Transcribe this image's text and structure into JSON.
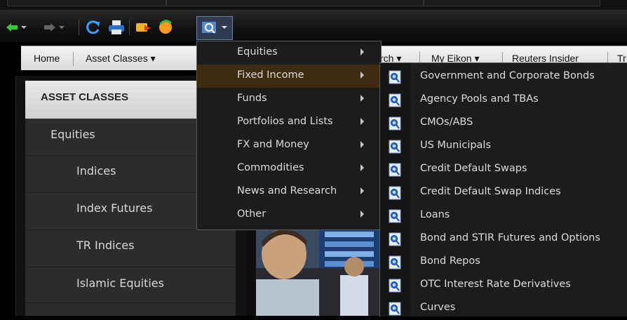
{
  "nav": {
    "home": "Home",
    "asset_classes": "Asset Classes ▾",
    "search": "rch ▾",
    "my_eikon": "My Eikon ▾",
    "reuters_insider": "Reuters Insider",
    "more": "Tr"
  },
  "left_panel": {
    "title": "ASSET CLASSES",
    "items": [
      {
        "label": "Equities"
      },
      {
        "label": "Indices"
      },
      {
        "label": "Index Futures"
      },
      {
        "label": "TR Indices"
      },
      {
        "label": "Islamic Equities"
      }
    ]
  },
  "menu_main": {
    "items": [
      {
        "label": "Equities"
      },
      {
        "label": "Fixed Income",
        "highlighted": true
      },
      {
        "label": "Funds"
      },
      {
        "label": "Portfolios and Lists"
      },
      {
        "label": "FX and Money"
      },
      {
        "label": "Commodities"
      },
      {
        "label": "News and Research"
      },
      {
        "label": "Other"
      }
    ]
  },
  "menu_fixed_income": {
    "items": [
      {
        "label": "Government and Corporate Bonds"
      },
      {
        "label": "Agency Pools and TBAs"
      },
      {
        "label": "CMOs/ABS"
      },
      {
        "label": "US Municipals"
      },
      {
        "label": "Credit Default Swaps"
      },
      {
        "label": "Credit Default Swap Indices"
      },
      {
        "label": "Loans"
      },
      {
        "label": "Bond and STIR Futures and Options"
      },
      {
        "label": "Bond Repos"
      },
      {
        "label": "OTC Interest Rate Derivatives"
      },
      {
        "label": "Curves"
      }
    ]
  },
  "colors": {
    "highlight": "#3e2c10",
    "menu_bg": "#1c1c1c",
    "nav_bg": "#e4e4e4",
    "panel_bg": "#2c2c2c"
  },
  "icons": {
    "back": "arrow-left-icon",
    "forward": "arrow-right-icon",
    "refresh": "refresh-icon",
    "print": "print-icon",
    "send": "send-icon",
    "chat": "chat-icon",
    "search_app": "search-app-icon"
  }
}
